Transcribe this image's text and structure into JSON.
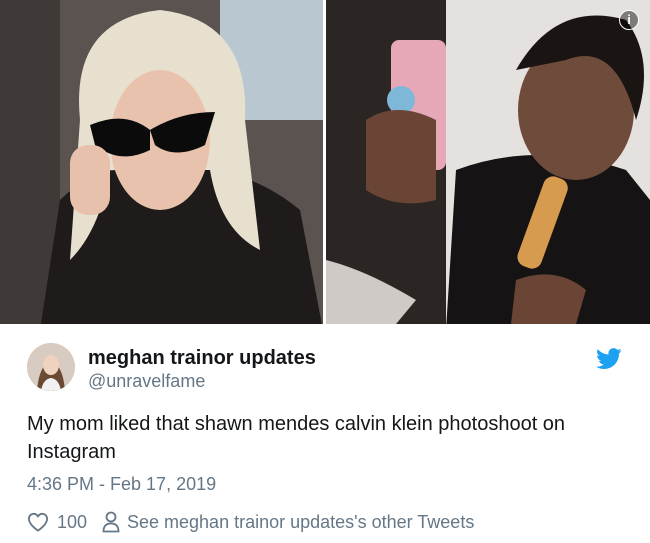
{
  "media": {
    "left_image_icon": "photo-woman-sunglasses",
    "right_image_icon": "photo-girl-phone-corndog",
    "info_icon": "info-icon",
    "info_glyph": "i"
  },
  "tweet": {
    "author": {
      "display_name": "meghan trainor updates",
      "handle": "@unravelfame",
      "avatar_icon": "avatar"
    },
    "text": "My mom liked that shawn mendes calvin klein photoshoot on Instagram",
    "timestamp": "4:36 PM - Feb 17, 2019",
    "likes": "100",
    "other_tweets_label": "See meghan trainor updates's other Tweets"
  },
  "colors": {
    "twitter_blue": "#1da1f2",
    "secondary_text": "#657786",
    "primary_text": "#14171a"
  }
}
